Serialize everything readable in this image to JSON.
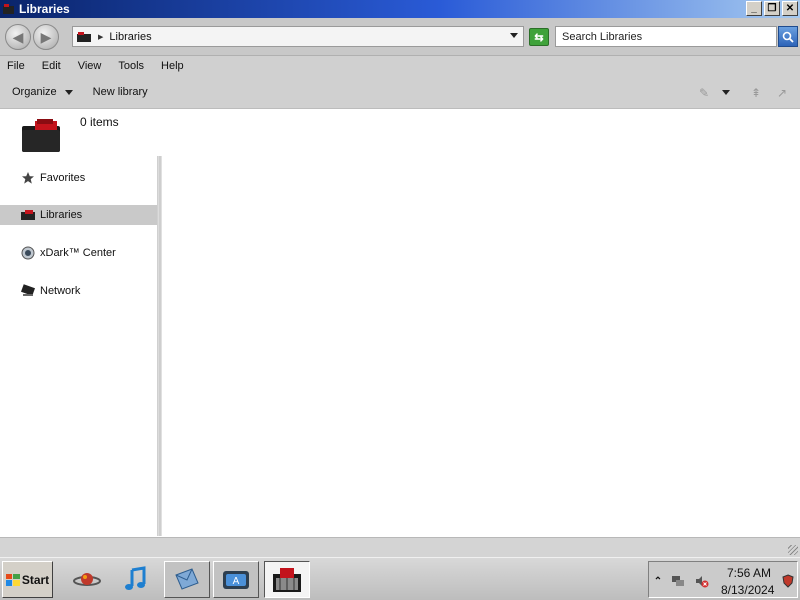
{
  "window": {
    "title": "Libraries"
  },
  "titlebar": {
    "minimize": "_",
    "restore": "❐",
    "close": "✕"
  },
  "address": {
    "path": "Libraries"
  },
  "search": {
    "placeholder": "Search Libraries"
  },
  "menu": [
    "File",
    "Edit",
    "View",
    "Tools",
    "Help"
  ],
  "toolbar": {
    "organize": "Organize",
    "new_library": "New library"
  },
  "details": {
    "item_count": "0 items"
  },
  "nav": [
    {
      "label": "Favorites",
      "icon": "star-icon"
    },
    {
      "label": "Libraries",
      "icon": "libraries-icon",
      "selected": true
    },
    {
      "label": "xDark™ Center",
      "icon": "xdark-center-icon"
    },
    {
      "label": "Network",
      "icon": "network-icon"
    }
  ],
  "taskbar": {
    "start": "Start",
    "apps": [
      "browser-icon",
      "music-icon",
      "mail-icon",
      "appstore-icon",
      "explorer-icon"
    ]
  },
  "tray": {
    "time": "7:56 AM",
    "date": "8/13/2024"
  },
  "colors": {
    "accent": "#2a5bd7",
    "selected": "#c9c9c9",
    "brand_red": "#c3131c"
  }
}
